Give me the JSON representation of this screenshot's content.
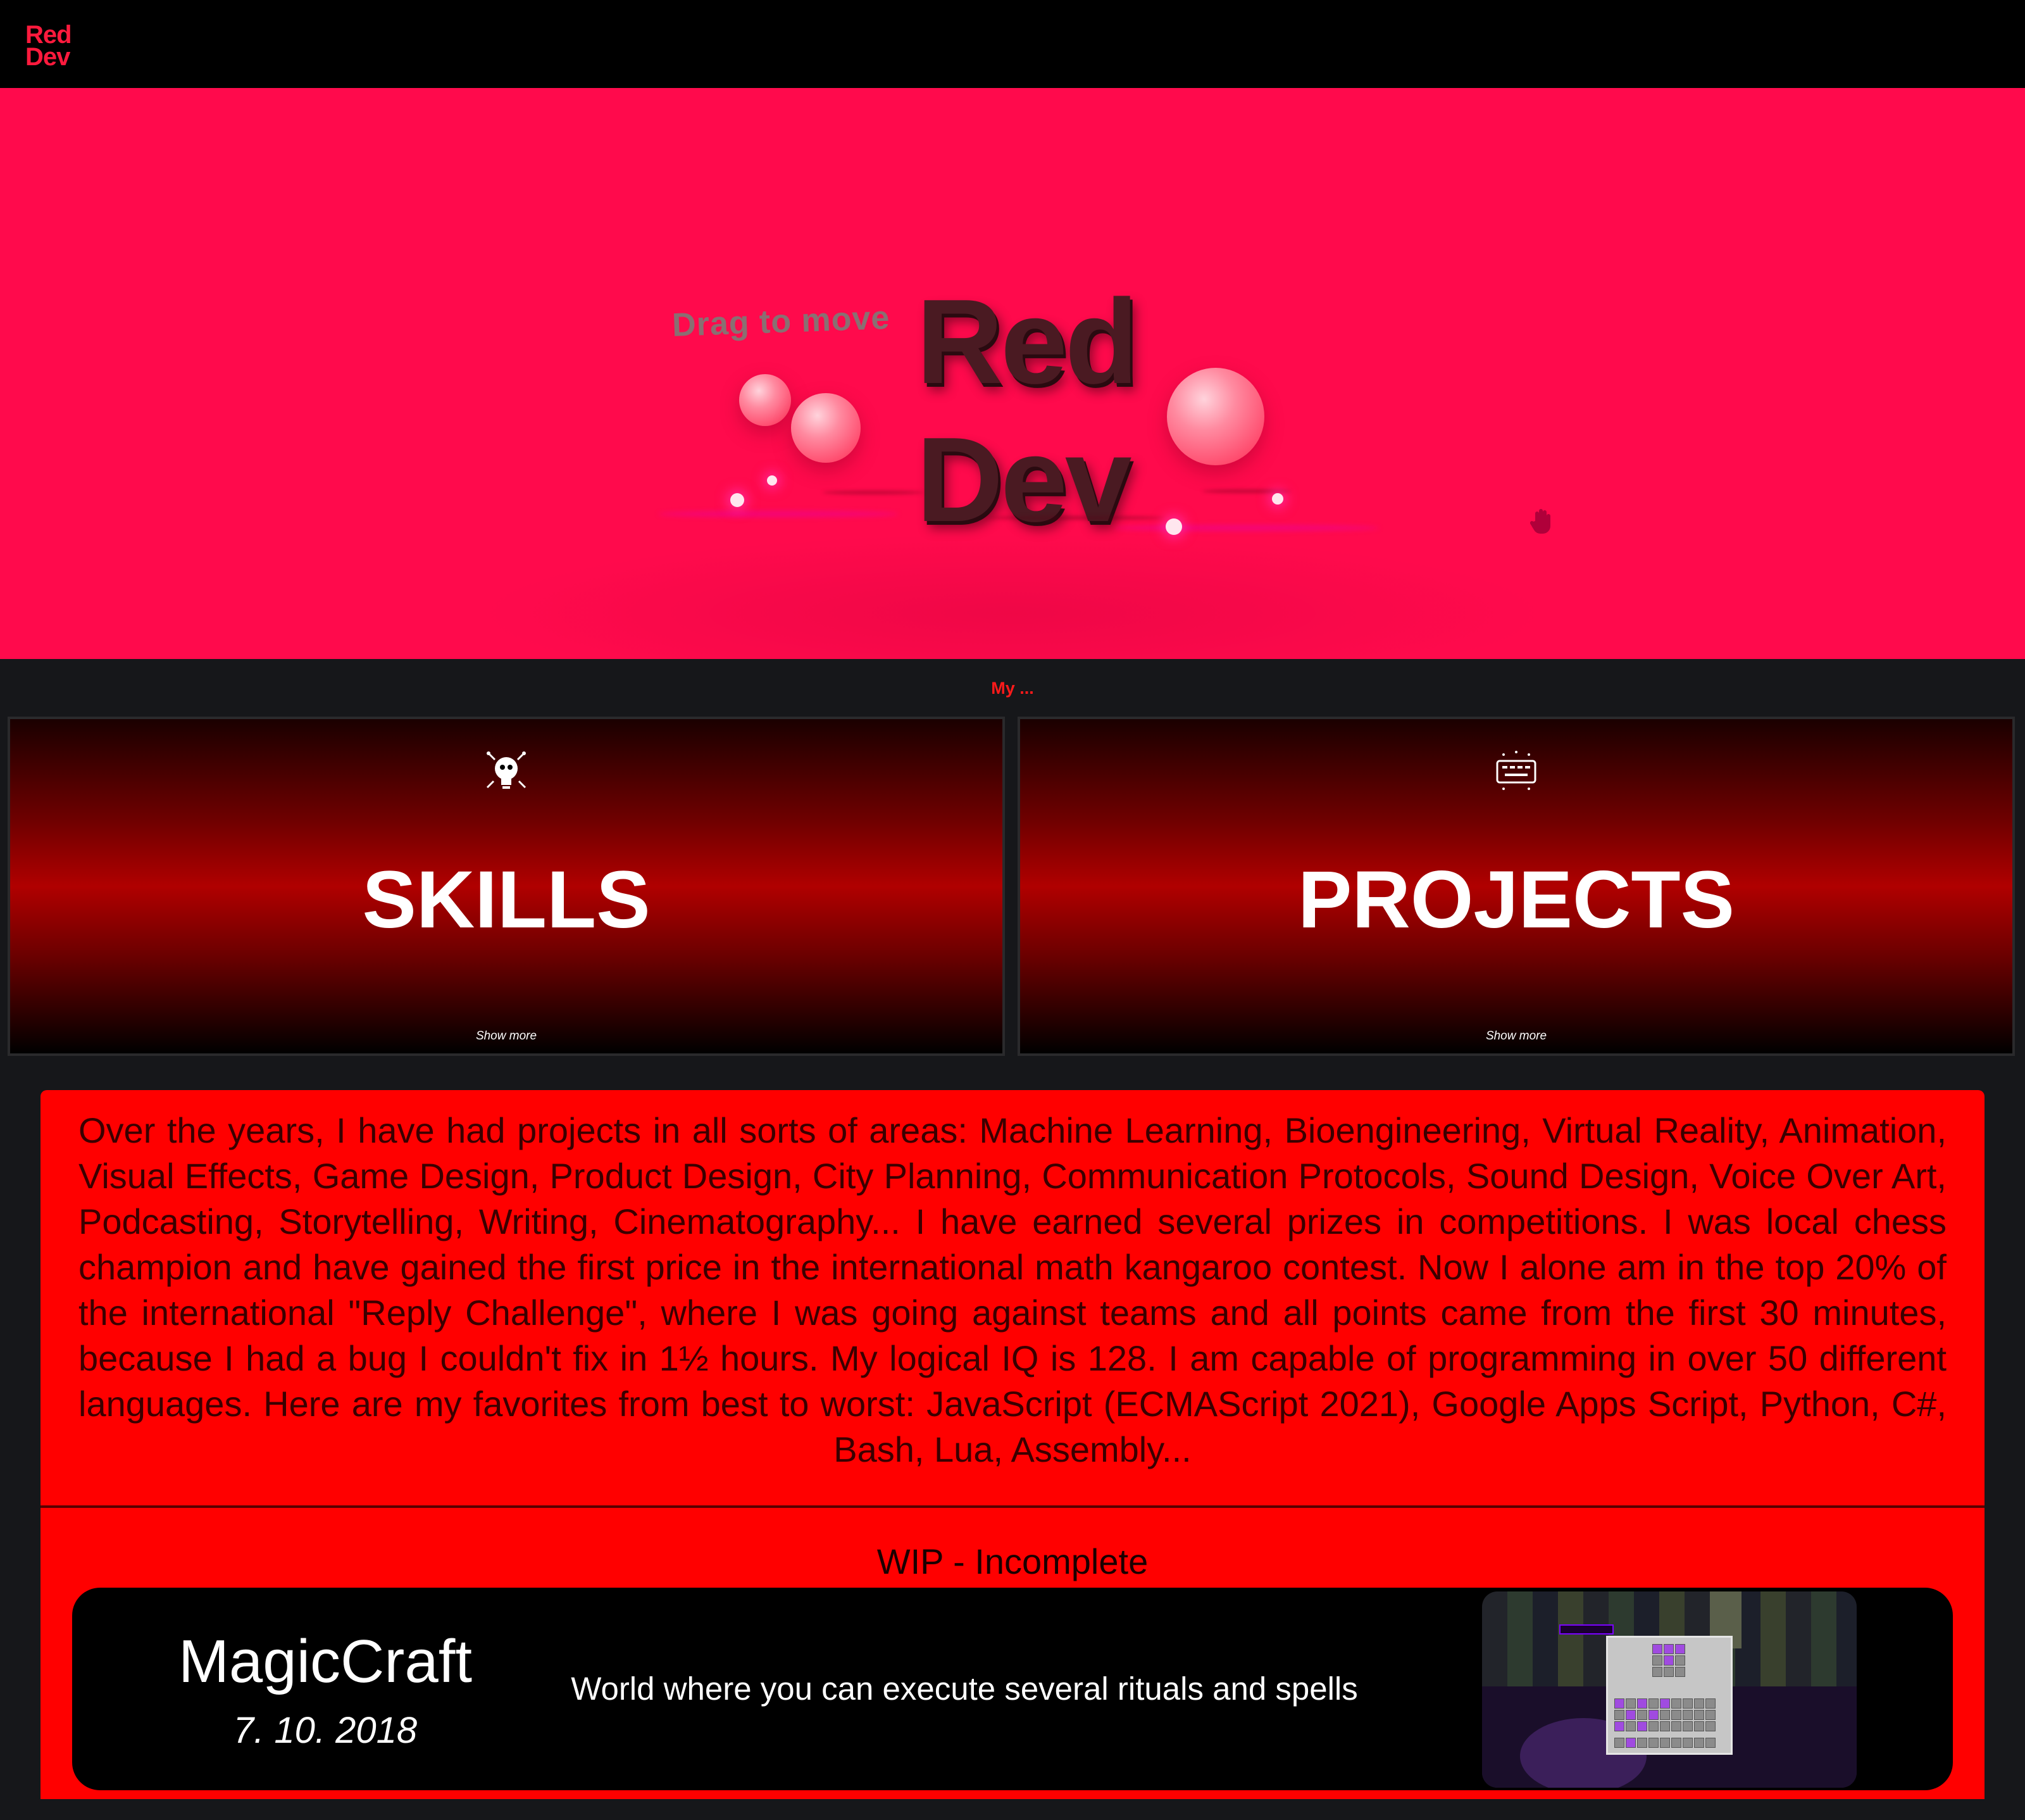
{
  "header": {
    "logo_line1": "Red",
    "logo_line2": "Dev"
  },
  "hero": {
    "drag_hint": "Drag to move",
    "title_line1": "Red",
    "title_line2": "Dev",
    "hand_icon": "hand-cursor-icon"
  },
  "section": {
    "label": "My ..."
  },
  "cards": [
    {
      "title": "SKILLS",
      "more": "Show more",
      "icon": "lightbulb-icon"
    },
    {
      "title": "PROJECTS",
      "more": "Show more",
      "icon": "keyboard-icon"
    }
  ],
  "info": {
    "text": "Over the years, I have had projects in all sorts of areas: Machine Learning, Bioengineering, Virtual Reality, Animation, Visual Effects, Game Design, Product Design, City Planning, Communication Protocols, Sound Design, Voice Over Art, Podcasting, Storytelling, Writing, Cinematography... I have earned several prizes in competitions. I was local chess champion and have gained the first price in the international math kangaroo contest. Now I alone am in the top 20% of the international \"Reply Challenge\", where I was going against teams and all points came from the first 30 minutes, because I had a bug I couldn't fix in 1½ hours. My logical IQ is 128. I am capable of programming in over 50 different languages. Here are my favorites from best to worst: JavaScript (ECMAScript 2021), Google Apps Script, Python, C#, Bash, Lua, Assembly..."
  },
  "wip": {
    "title": "WIP - Incomplete",
    "project": {
      "name": "MagicCraft",
      "date": "7. 10. 2018",
      "description": "World where you can execute several rituals and spells"
    }
  },
  "colors": {
    "hero_bg": "#ff0a4c",
    "accent": "#ff0000",
    "page_bg": "#16171a"
  }
}
